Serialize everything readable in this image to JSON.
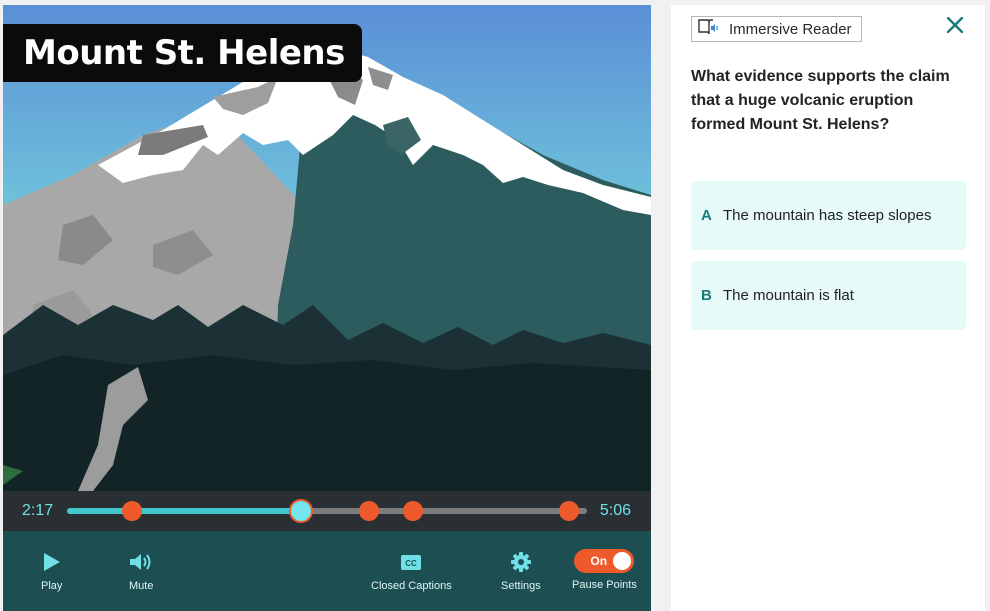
{
  "video": {
    "title": "Mount St. Helens",
    "current_time": "2:17",
    "total_time": "5:06",
    "progress_fraction": 0.45,
    "pause_point_fractions": [
      0.125,
      0.58,
      0.665,
      0.965
    ]
  },
  "controls": {
    "play_label": "Play",
    "mute_label": "Mute",
    "cc_icon_text": "CC",
    "cc_label": "Closed Captions",
    "settings_label": "Settings",
    "pause_points_label": "Pause Points",
    "pause_points_toggle": "On"
  },
  "panel": {
    "immersive_reader_label": "Immersive Reader",
    "question": "What evidence supports the claim that a huge volcanic eruption formed Mount St. Helens?",
    "answers": [
      {
        "letter": "A",
        "text": "The mountain has steep slopes"
      },
      {
        "letter": "B",
        "text": "The mountain is flat"
      }
    ]
  },
  "colors": {
    "accent": "#ee5a2b",
    "teal": "#187a79",
    "progress": "#3fc9cc",
    "control_bar": "#1d4f52"
  }
}
